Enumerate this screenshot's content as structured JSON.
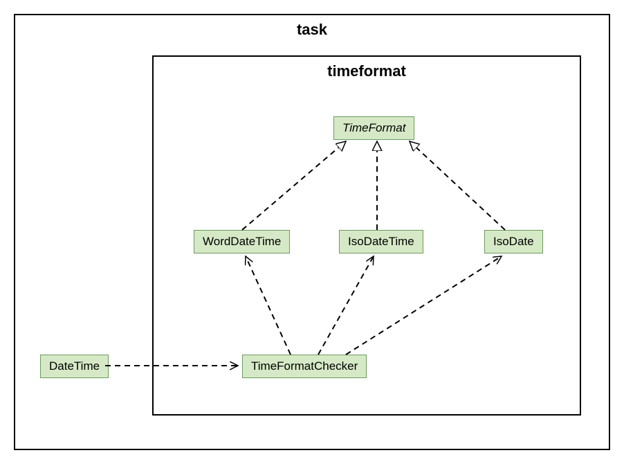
{
  "outer_package": "task",
  "inner_package": "timeformat",
  "classes": {
    "timeformat": "TimeFormat",
    "worddatetime": "WordDateTime",
    "isodatetime": "IsoDateTime",
    "isodate": "IsoDate",
    "timeformatchecker": "TimeFormatChecker",
    "datetime": "DateTime"
  },
  "chart_data": {
    "type": "uml_class_diagram",
    "packages": [
      {
        "name": "task",
        "contains": [
          "DateTime",
          "timeformat"
        ]
      },
      {
        "name": "timeformat",
        "parent": "task",
        "contains": [
          "TimeFormat",
          "WordDateTime",
          "IsoDateTime",
          "IsoDate",
          "TimeFormatChecker"
        ]
      }
    ],
    "classes": [
      {
        "name": "TimeFormat",
        "abstract": true,
        "package": "timeformat"
      },
      {
        "name": "WordDateTime",
        "abstract": false,
        "package": "timeformat"
      },
      {
        "name": "IsoDateTime",
        "abstract": false,
        "package": "timeformat"
      },
      {
        "name": "IsoDate",
        "abstract": false,
        "package": "timeformat"
      },
      {
        "name": "TimeFormatChecker",
        "abstract": false,
        "package": "timeformat"
      },
      {
        "name": "DateTime",
        "abstract": false,
        "package": "task"
      }
    ],
    "relationships": [
      {
        "from": "WordDateTime",
        "to": "TimeFormat",
        "type": "realization"
      },
      {
        "from": "IsoDateTime",
        "to": "TimeFormat",
        "type": "realization"
      },
      {
        "from": "IsoDate",
        "to": "TimeFormat",
        "type": "realization"
      },
      {
        "from": "TimeFormatChecker",
        "to": "WordDateTime",
        "type": "dependency"
      },
      {
        "from": "TimeFormatChecker",
        "to": "IsoDateTime",
        "type": "dependency"
      },
      {
        "from": "TimeFormatChecker",
        "to": "IsoDate",
        "type": "dependency"
      },
      {
        "from": "DateTime",
        "to": "TimeFormatChecker",
        "type": "dependency"
      }
    ]
  }
}
